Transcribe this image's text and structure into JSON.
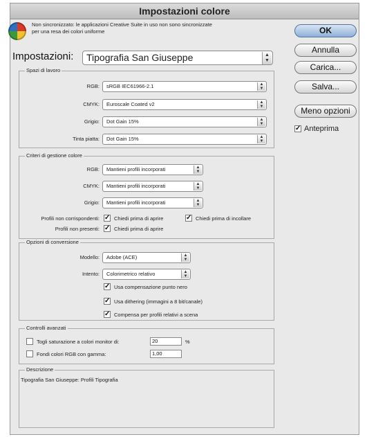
{
  "window": {
    "title": "Impostazioni colore"
  },
  "notice": {
    "text": "Non sincronizzato: le applicazioni Creative Suite in uso non sono sincronizzate per una resa dei colori uniforme"
  },
  "settings": {
    "label": "Impostazioni:",
    "value": "Tipografia San Giuseppe"
  },
  "workspaces": {
    "title": "Spazi di lavoro",
    "rows": [
      {
        "label": "RGB:",
        "value": "sRGB IEC61966-2.1"
      },
      {
        "label": "CMYK:",
        "value": "Euroscale Coated v2"
      },
      {
        "label": "Grigio:",
        "value": "Dot Gain 15%"
      },
      {
        "label": "Tinta piatta:",
        "value": "Dot Gain 15%"
      }
    ]
  },
  "policies": {
    "title": "Criteri di gestione colore",
    "rows": [
      {
        "label": "RGB:",
        "value": "Mantieni profili incorporati"
      },
      {
        "label": "CMYK:",
        "value": "Mantieni profili incorporati"
      },
      {
        "label": "Grigio:",
        "value": "Mantieni profili incorporati"
      }
    ],
    "mismatch_label": "Profili non corrispondenti:",
    "ask_open": "Chiedi prima di aprire",
    "ask_paste": "Chiedi prima di incollare",
    "missing_label": "Profili non presenti:",
    "ask_open_missing": "Chiedi prima di aprire"
  },
  "conversion": {
    "title": "Opzioni di conversione",
    "engine_label": "Modello:",
    "engine_value": "Adobe (ACE)",
    "intent_label": "Intento:",
    "intent_value": "Colorimetrico relativo",
    "black_point": "Usa compensazione punto nero",
    "dither": "Usa dithering (immagini a 8 bit/canale)",
    "compensate": "Compensa per profili relativi a scena"
  },
  "advanced": {
    "title": "Controlli avanzati",
    "desaturate_label": "Togli saturazione a colori monitor di:",
    "desaturate_value": "20",
    "desaturate_unit": "%",
    "blend_label": "Fondi colori RGB con gamma:",
    "blend_value": "1,00"
  },
  "description": {
    "title": "Descrizione",
    "text": "Tipografia San Giuseppe:  Profili Tipografia"
  },
  "buttons": {
    "ok": "OK",
    "cancel": "Annulla",
    "load": "Carica...",
    "save": "Salva...",
    "fewer": "Meno opzioni",
    "preview": "Anteprima"
  }
}
